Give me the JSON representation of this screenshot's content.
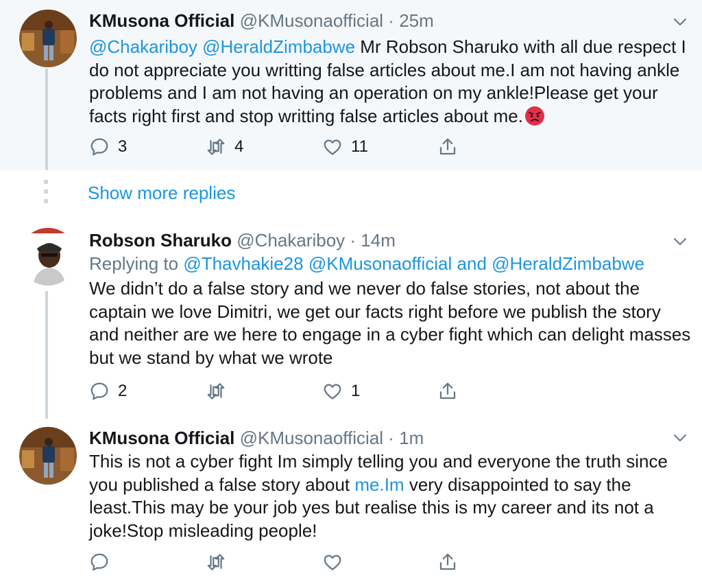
{
  "tweets": [
    {
      "name": "KMusona Official",
      "handle": "@KMusonaofficial",
      "separator": "·",
      "time": "25m",
      "mention1": "@Chakariboy",
      "mention2": "@HeraldZimbabwe",
      "text": " Mr Robson Sharuko with all due respect I do not appreciate you writting false articles about me.I am not having ankle problems and I am not having an operation on my ankle!Please get your facts right first and stop writting false articles about me.",
      "emoji": "angry-face",
      "replies": "3",
      "retweets": "4",
      "likes": "11"
    },
    {
      "name": "Robson Sharuko",
      "handle": "@Chakariboy",
      "separator": "·",
      "time": "14m",
      "replying_to": "Replying to ",
      "reply_mention1": "@Thavhakie28",
      "reply_mention2": "@KMusonaofficial",
      "reply_and": " and ",
      "reply_mention3": "@HeraldZimbabwe",
      "text": "We didn’t do a false story and we never do false stories, not about the captain we love Dimitri, we get our facts right before we publish the story and neither are we here to engage in a cyber fight which can delight masses but we stand by what we wrote",
      "replies": "2",
      "retweets": "",
      "likes": "1"
    },
    {
      "name": "KMusona Official",
      "handle": "@KMusonaofficial",
      "separator": "·",
      "time": "1m",
      "text_before": "This is not a cyber fight Im simply telling you and everyone the truth since you published a false story about ",
      "link": "me.Im",
      "text_after": " very disappointed to say the least.This may be your job yes but realise this is my career and its not a joke!Stop misleading people!",
      "replies": "",
      "retweets": "",
      "likes": ""
    }
  ],
  "show_more": "Show more replies",
  "colors": {
    "link": "#1b95e0",
    "muted": "#657786",
    "highlight_bg": "#f5f8fa",
    "thread_line": "#ccd6dd"
  },
  "icons": [
    "reply-icon",
    "retweet-icon",
    "like-icon",
    "share-icon",
    "chevron-down-icon",
    "angry-face-emoji"
  ]
}
